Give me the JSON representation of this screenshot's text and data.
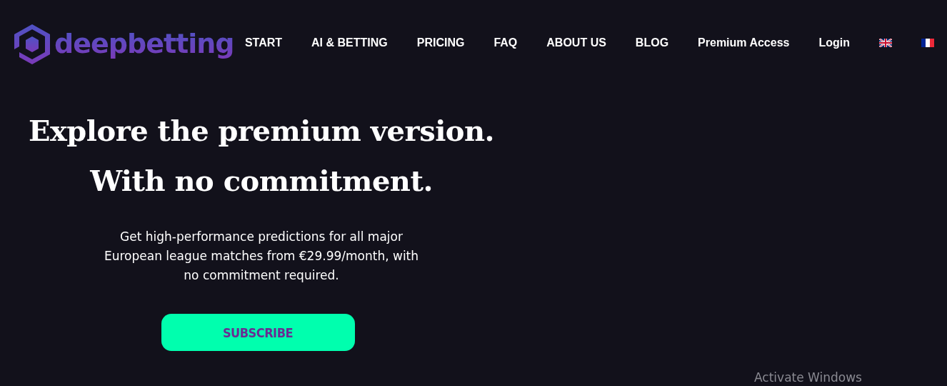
{
  "logo": {
    "text": "deepbetting"
  },
  "nav": [
    {
      "label": "START",
      "kind": "link"
    },
    {
      "label": "AI & BETTING",
      "kind": "link"
    },
    {
      "label": "PRICING",
      "kind": "link"
    },
    {
      "label": "FAQ",
      "kind": "link"
    },
    {
      "label": "ABOUT US",
      "kind": "link"
    },
    {
      "label": "BLOG",
      "kind": "link"
    },
    {
      "label": "Premium Access",
      "kind": "link"
    },
    {
      "label": "Login",
      "kind": "link"
    },
    {
      "kind": "flag-uk"
    },
    {
      "kind": "flag-fr"
    }
  ],
  "hero": {
    "headline": [
      "Explore the premium version.",
      "With no commitment."
    ],
    "description": "Get high-performance predictions for all major European league matches from €29.99/month, with no commitment required.",
    "button": "SUBSCRIBE"
  },
  "system_notice": "Activate Windows"
}
